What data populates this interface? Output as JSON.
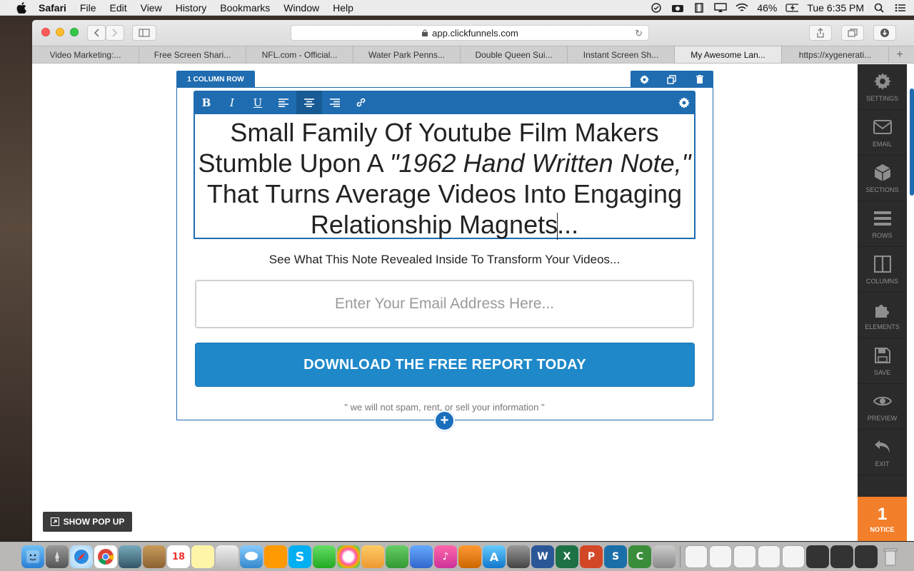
{
  "menubar": {
    "app": "Safari",
    "items": [
      "File",
      "Edit",
      "View",
      "History",
      "Bookmarks",
      "Window",
      "Help"
    ],
    "battery": "46%",
    "clock": "Tue 6:35 PM"
  },
  "browser": {
    "url": "app.clickfunnels.com",
    "tabs": [
      {
        "label": "Video Marketing:..."
      },
      {
        "label": "Free Screen Shari..."
      },
      {
        "label": "NFL.com - Official..."
      },
      {
        "label": "Water Park Penns..."
      },
      {
        "label": "Double Queen Sui..."
      },
      {
        "label": "Instant Screen Sh..."
      },
      {
        "label": "My Awesome Lan..."
      },
      {
        "label": "https://xygenerati..."
      }
    ]
  },
  "editor": {
    "row_label": "1 COLUMN ROW",
    "format_buttons": [
      "B",
      "I",
      "U"
    ],
    "headline": {
      "part1": "Small Family Of Youtube Film Makers Stumble Upon A ",
      "italic": "\"1962 Hand Written Note,\"",
      "part2": " That Turns Average Videos Into Engaging Relationship Magnets",
      "part3": "..."
    },
    "subheadline": "See What This Note Revealed Inside To Transform Your Videos...",
    "email_placeholder": "Enter Your Email Address Here...",
    "cta_label": "DOWNLOAD THE FREE REPORT TODAY",
    "privacy": "\"  we will not spam, rent, or sell your information \"",
    "add_symbol": "+",
    "show_popup": "SHOW POP UP"
  },
  "sidebar": {
    "items": [
      {
        "label": "SETTINGS",
        "icon": "gear-icon"
      },
      {
        "label": "EMAIL",
        "icon": "envelope-icon"
      },
      {
        "label": "SECTIONS",
        "icon": "cube-icon"
      },
      {
        "label": "ROWS",
        "icon": "rows-icon"
      },
      {
        "label": "COLUMNS",
        "icon": "columns-icon"
      },
      {
        "label": "ELEMENTS",
        "icon": "puzzle-icon"
      },
      {
        "label": "SAVE",
        "icon": "floppy-icon"
      },
      {
        "label": "PREVIEW",
        "icon": "eye-icon"
      },
      {
        "label": "EXIT",
        "icon": "undo-icon"
      }
    ],
    "notice_count": "1",
    "notice_label": "NOTICE"
  },
  "colors": {
    "editor_blue": "#1f6cb0",
    "cta_blue": "#1e88c9",
    "sidebar_bg": "#2b2b2b",
    "notice_orange": "#f47f2a"
  }
}
